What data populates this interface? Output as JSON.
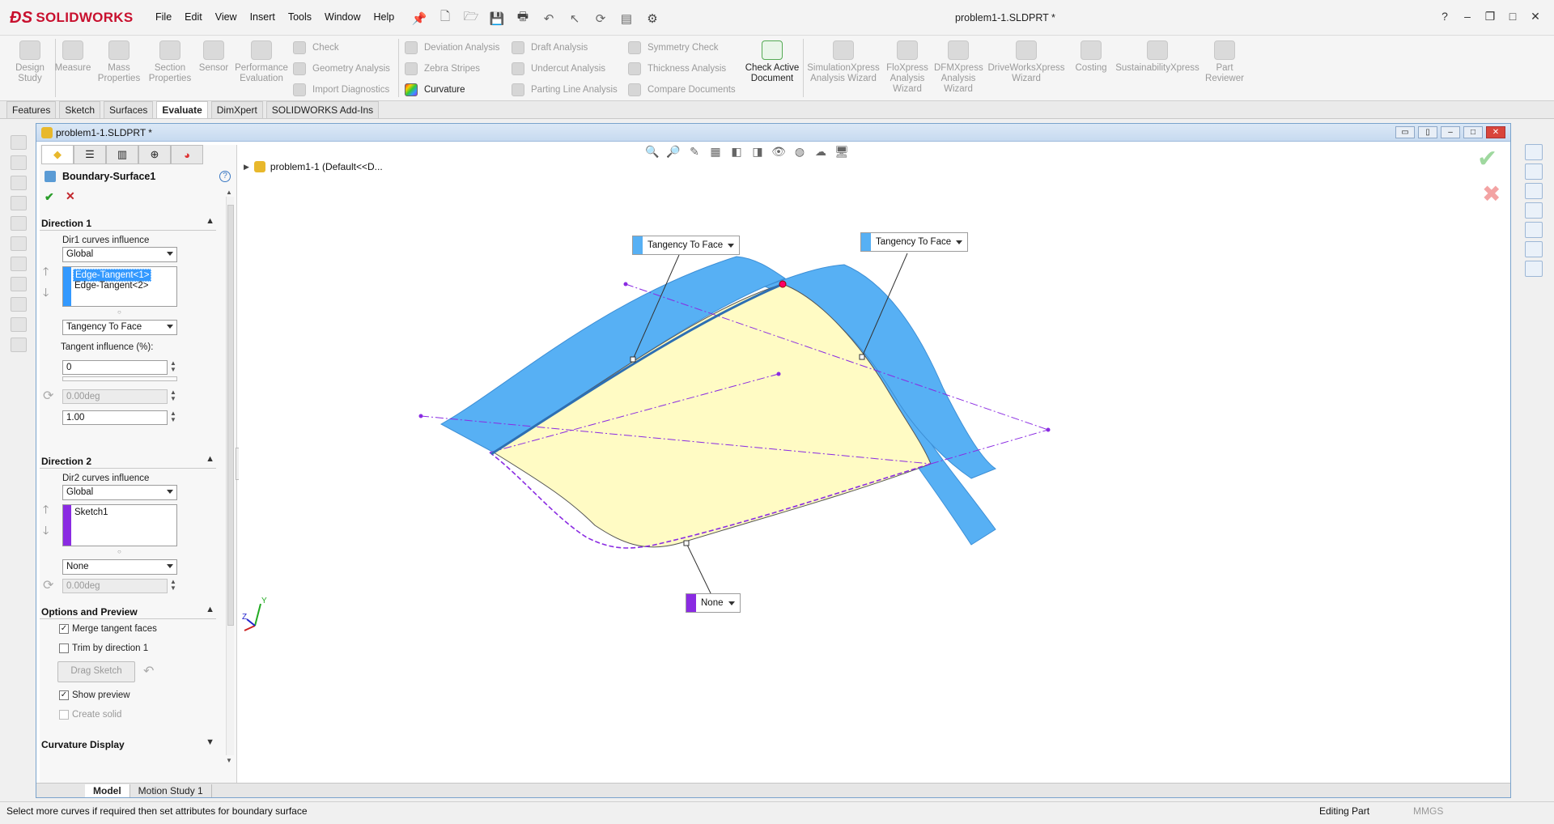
{
  "app": {
    "name": "SOLIDWORKS",
    "document_title": "problem1-1.SLDPRT *"
  },
  "menu": [
    "File",
    "Edit",
    "View",
    "Insert",
    "Tools",
    "Window",
    "Help"
  ],
  "toolbar": {
    "design_study": "Design Study",
    "measure": "Measure",
    "mass_properties": "Mass Properties",
    "section_properties": "Section Properties",
    "sensor": "Sensor",
    "performance_evaluation": "Performance Evaluation",
    "check": "Check",
    "geometry_analysis": "Geometry Analysis",
    "import_diagnostics": "Import Diagnostics",
    "deviation_analysis": "Deviation Analysis",
    "zebra_stripes": "Zebra Stripes",
    "curvature": "Curvature",
    "draft_analysis": "Draft Analysis",
    "undercut_analysis": "Undercut Analysis",
    "parting_line_analysis": "Parting Line Analysis",
    "symmetry_check": "Symmetry Check",
    "thickness_analysis": "Thickness Analysis",
    "compare_documents": "Compare Documents",
    "check_active_document": "Check Active Document",
    "simulationxpress": "SimulationXpress Analysis Wizard",
    "floxpress": "FloXpress Analysis Wizard",
    "dfmxpress": "DFMXpress Analysis Wizard",
    "driveworksxpress": "DriveWorksXpress Wizard",
    "costing": "Costing",
    "sustainabilityxpress": "SustainabilityXpress",
    "part_reviewer": "Part Reviewer"
  },
  "tabs": [
    "Features",
    "Sketch",
    "Surfaces",
    "Evaluate",
    "DimXpert",
    "SOLIDWORKS Add-Ins"
  ],
  "active_tab": "Evaluate",
  "doc_window": {
    "title": "problem1-1.SLDPRT *"
  },
  "property_manager": {
    "title": "Boundary-Surface1",
    "direction1": {
      "header": "Direction 1",
      "curves_influence_label": "Dir1 curves influence",
      "curves_influence_value": "Global",
      "items": [
        "Edge-Tangent<1>",
        "Edge-Tangent<2>"
      ],
      "tangency_type": "Tangency To Face",
      "tangent_influence_label": "Tangent influence (%):",
      "tangent_influence_value": "0",
      "angle_value": "0.00deg",
      "length_value": "1.00"
    },
    "direction2": {
      "header": "Direction 2",
      "curves_influence_label": "Dir2 curves influence",
      "curves_influence_value": "Global",
      "items": [
        "Sketch1"
      ],
      "tangency_type": "None",
      "angle_value": "0.00deg"
    },
    "options": {
      "header": "Options and Preview",
      "merge_tangent_faces": "Merge tangent faces",
      "trim_by_direction1": "Trim by direction 1",
      "drag_sketch": "Drag Sketch",
      "show_preview": "Show preview",
      "create_solid": "Create solid"
    },
    "curvature_display": {
      "header": "Curvature Display"
    }
  },
  "feature_tree": {
    "root": "problem1-1  (Default<<D..."
  },
  "callouts": {
    "left": "Tangency To Face",
    "right": "Tangency To Face",
    "bottom": "None"
  },
  "bottom_tabs": [
    "Model",
    "Motion Study 1"
  ],
  "status": {
    "message": "Select more curves if required then set attributes for boundary surface",
    "mode": "Editing Part",
    "units": "MMGS"
  },
  "colors": {
    "surface_blue": "#57b0f4",
    "surface_yellow": "#fffbc4",
    "sketch_purple": "#8a2be2",
    "selection_blue": "#3399ff"
  }
}
